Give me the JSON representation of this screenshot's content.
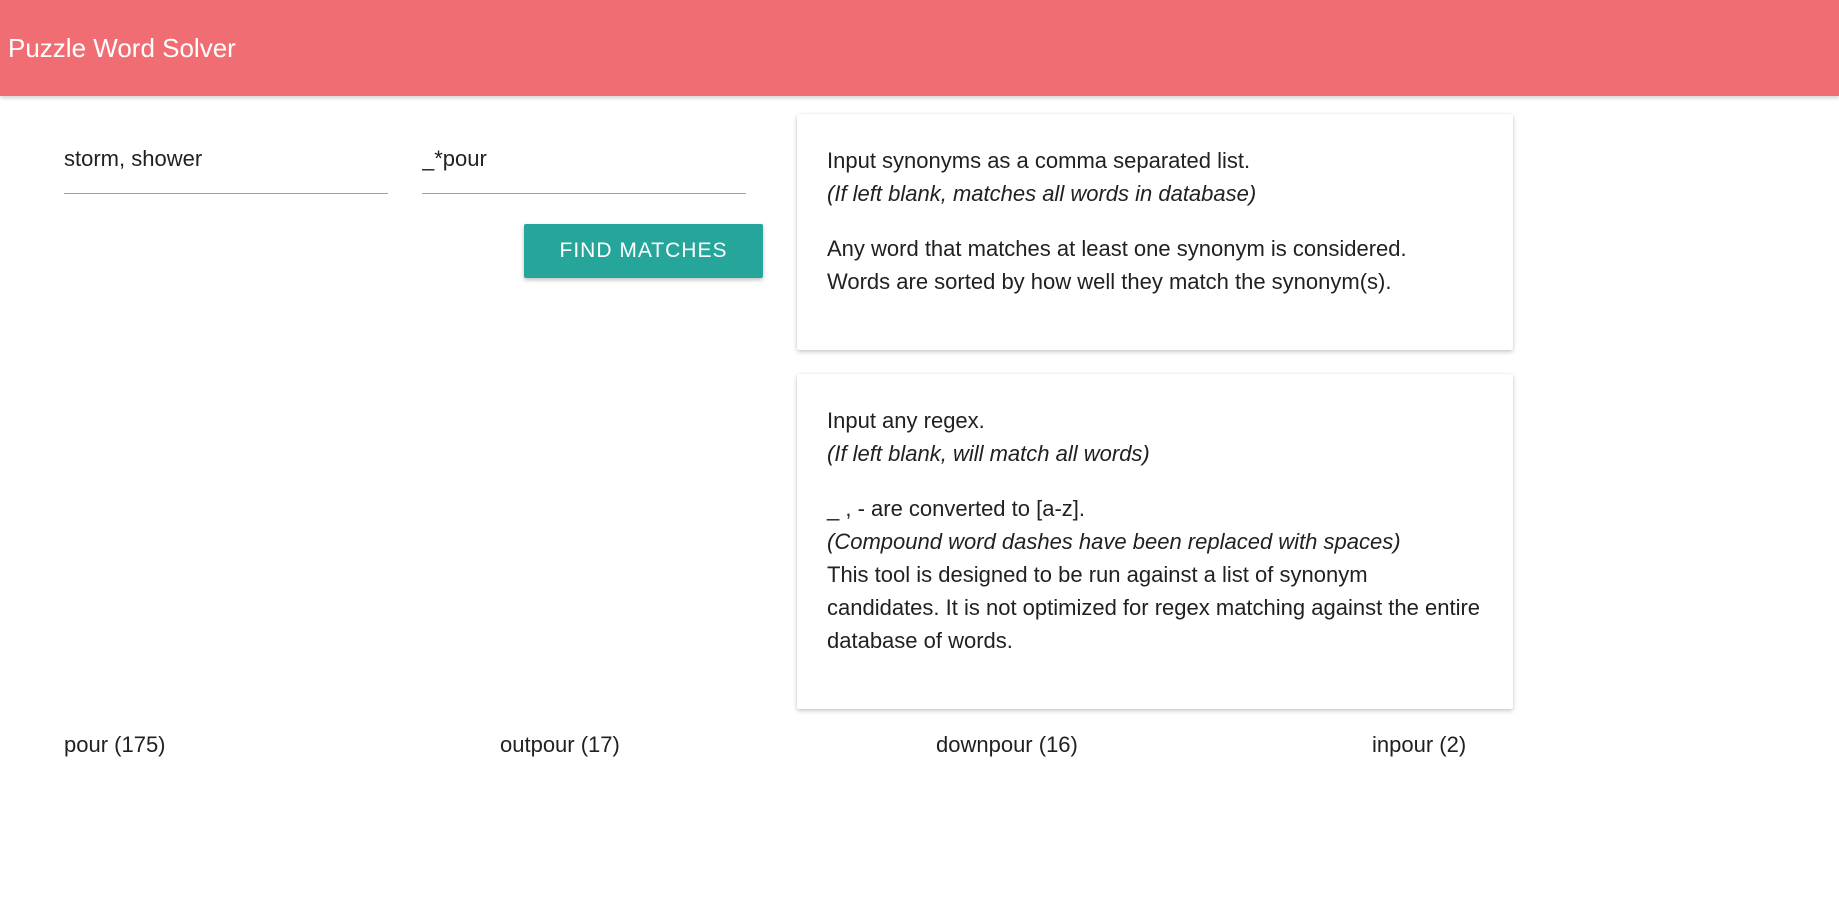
{
  "header": {
    "title": "Puzzle Word Solver",
    "color": "#f06e73"
  },
  "form": {
    "synonyms_value": "storm, shower",
    "regex_value": "_*pour",
    "find_label": "FIND MATCHES",
    "button_color": "#26a69a"
  },
  "synonyms_help": {
    "line1": "Input synonyms as a comma separated list.",
    "line2": "(If left blank, matches all words in database)",
    "line3": "Any word that matches at least one synonym is considered.",
    "line4": "Words are sorted by how well they match the synonym(s)."
  },
  "regex_help": {
    "line1": "Input any regex.",
    "line2": "(If left blank, will match all words)",
    "line3": "_ , - are converted to [a-z].",
    "line4": "(Compound word dashes have been replaced with spaces)",
    "line5": "This tool is designed to be run against a list of synonym candidates. It is not optimized for regex matching against the entire database of words."
  },
  "results": [
    "pour (175)",
    "outpour (17)",
    "downpour (16)",
    "inpour (2)"
  ]
}
